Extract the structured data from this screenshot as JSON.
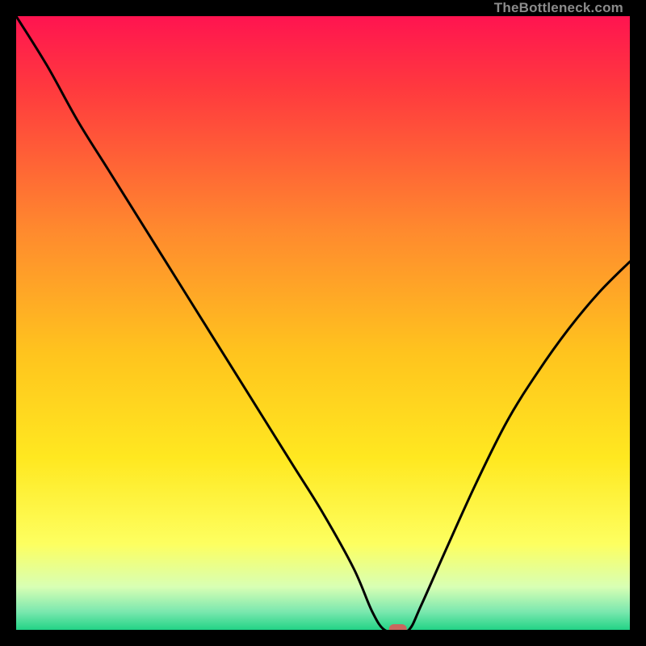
{
  "watermark": "TheBottleneck.com",
  "chart_data": {
    "type": "line",
    "x": [
      0.0,
      0.05,
      0.1,
      0.15,
      0.2,
      0.25,
      0.3,
      0.35,
      0.4,
      0.45,
      0.5,
      0.55,
      0.58,
      0.6,
      0.62,
      0.64,
      0.66,
      0.7,
      0.75,
      0.8,
      0.85,
      0.9,
      0.95,
      1.0
    ],
    "values": [
      100,
      92,
      83,
      75,
      67,
      59,
      51,
      43,
      35,
      27,
      19,
      10,
      3,
      0,
      0,
      0,
      4,
      13,
      24,
      34,
      42,
      49,
      55,
      60
    ],
    "title": "",
    "xlabel": "",
    "ylabel": "",
    "xlim": [
      0,
      1
    ],
    "ylim": [
      0,
      100
    ],
    "marker": {
      "x": 0.622,
      "y": 0
    },
    "gradient": {
      "stops": [
        {
          "offset": 0.0,
          "color": "#ff1450"
        },
        {
          "offset": 0.12,
          "color": "#ff3a3e"
        },
        {
          "offset": 0.35,
          "color": "#ff8a2e"
        },
        {
          "offset": 0.55,
          "color": "#ffc41e"
        },
        {
          "offset": 0.72,
          "color": "#ffe820"
        },
        {
          "offset": 0.86,
          "color": "#fdff60"
        },
        {
          "offset": 0.93,
          "color": "#d8ffb4"
        },
        {
          "offset": 0.97,
          "color": "#7CE8AF"
        },
        {
          "offset": 1.0,
          "color": "#22d386"
        }
      ]
    }
  }
}
